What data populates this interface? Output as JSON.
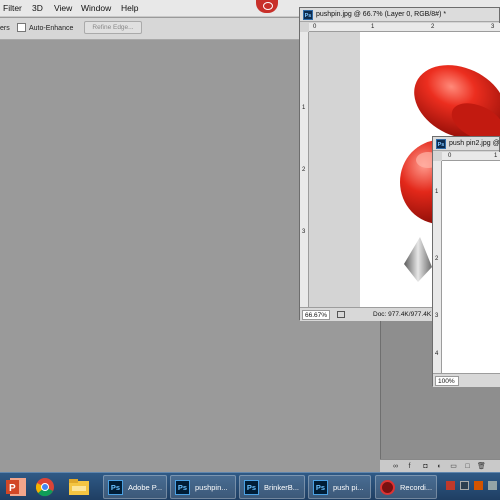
{
  "menu": {
    "items": [
      "Filter",
      "3D",
      "View",
      "Window",
      "Help"
    ]
  },
  "options": {
    "partial_label": "ers",
    "auto_enhance_label": "Auto-Enhance",
    "auto_enhance_checked": false,
    "refine_edge_label": "Refine Edge..."
  },
  "doc1": {
    "title": "pushpin.jpg @ 66.7% (Layer 0, RGB/8#) *",
    "ruler_h": [
      "0",
      "1",
      "2",
      "3"
    ],
    "ruler_v": [
      "1",
      "2",
      "3"
    ],
    "zoom": "66.67%",
    "doc_info": "Doc: 977.4K/977.4K"
  },
  "doc2": {
    "title": "push pin2.jpg @",
    "ruler_h": [
      "0",
      "1"
    ],
    "ruler_v": [
      "1",
      "2",
      "3",
      "4"
    ],
    "zoom": "100%"
  },
  "panel_icons": [
    "link-icon",
    "fx-icon",
    "mask-icon",
    "adjustment-icon",
    "folder-icon",
    "new-layer-icon",
    "trash-icon"
  ],
  "taskbar": {
    "pinned": [
      "powerpoint-icon",
      "chrome-icon",
      "file-explorer-icon"
    ],
    "buttons": [
      {
        "icon": "Ps",
        "label": "Adobe P..."
      },
      {
        "icon": "Ps",
        "label": "pushpin..."
      },
      {
        "icon": "Ps",
        "label": "BrinkerB..."
      },
      {
        "icon": "Ps",
        "label": "push pi..."
      },
      {
        "icon": "rec",
        "label": "Recordi..."
      }
    ]
  },
  "colors": {
    "pin_red": "#e0241a",
    "workspace_gray": "#9a9a9a",
    "taskbar_blue": "#2a4f79"
  }
}
